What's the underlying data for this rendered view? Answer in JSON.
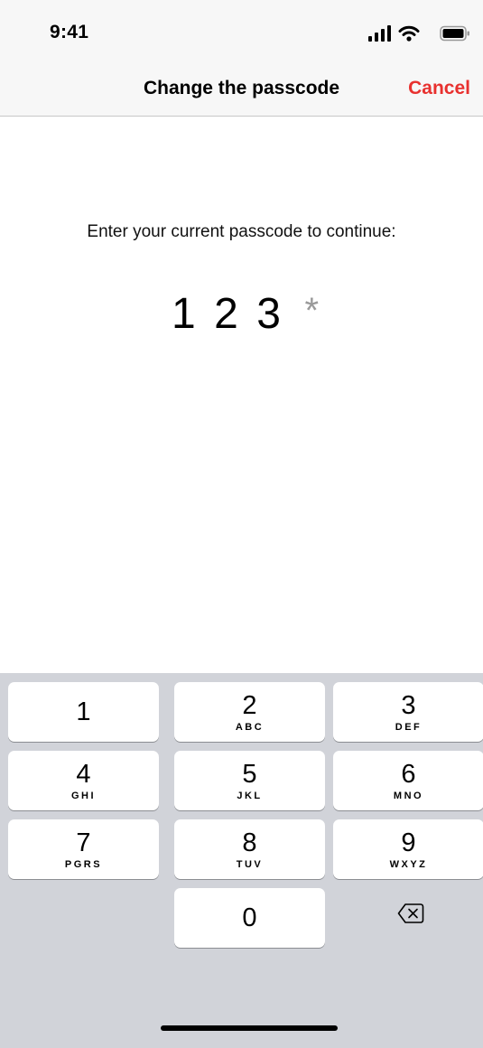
{
  "status_bar": {
    "time": "9:41",
    "icons": [
      "signal-icon",
      "wifi-icon",
      "battery-icon"
    ]
  },
  "nav": {
    "title": "Change the passcode",
    "cancel_label": "Cancel",
    "accent_color": "#e8312f"
  },
  "prompt": "Enter your current passcode to continue:",
  "passcode": {
    "digits": [
      "1",
      "2",
      "3"
    ],
    "placeholder": "*"
  },
  "keypad": {
    "keys": [
      {
        "num": "1",
        "letters": ""
      },
      {
        "num": "2",
        "letters": "ABC"
      },
      {
        "num": "3",
        "letters": "DEF"
      },
      {
        "num": "4",
        "letters": "GHI"
      },
      {
        "num": "5",
        "letters": "JKL"
      },
      {
        "num": "6",
        "letters": "MNO"
      },
      {
        "num": "7",
        "letters": "PGRS"
      },
      {
        "num": "8",
        "letters": "TUV"
      },
      {
        "num": "9",
        "letters": "WXYZ"
      },
      {
        "num": "0",
        "letters": ""
      }
    ],
    "delete_icon": "delete-backspace-icon"
  }
}
